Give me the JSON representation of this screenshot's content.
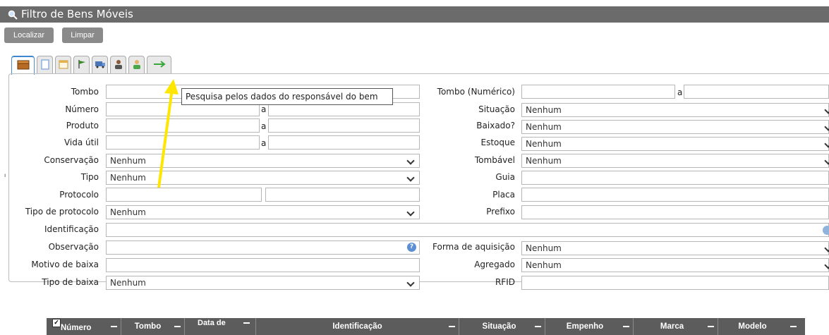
{
  "window": {
    "title": "Filtro de Bens Móveis"
  },
  "toolbar": {
    "search_label": "Localizar",
    "clear_label": "Limpar"
  },
  "tooltip": {
    "text": "Pesquisa pelos dados do responsável do bem"
  },
  "form": {
    "left": {
      "tombo": "Tombo",
      "numero": "Número",
      "produto": "Produto",
      "vida_util": "Vida útil",
      "conservacao": "Conservação",
      "tipo": "Tipo",
      "protocolo": "Protocolo",
      "tipo_protocolo": "Tipo de protocolo",
      "identificacao": "Identificação",
      "observacao": "Observação",
      "motivo_baixa": "Motivo de baixa",
      "tipo_baixa": "Tipo de baixa"
    },
    "right": {
      "tombo_numerico": "Tombo (Numérico)",
      "situacao": "Situação",
      "baixado": "Baixado?",
      "estoque": "Estoque",
      "tombavel": "Tombável",
      "guia": "Guia",
      "placa": "Placa",
      "prefixo": "Prefixo",
      "forma_aquisicao": "Forma de aquisição",
      "agregado": "Agregado",
      "rfid": "RFID"
    },
    "range_sep": "a",
    "select_default": "Nenhum"
  },
  "grid": {
    "columns": [
      "Número",
      "Tombo",
      "Data de",
      "Identificação",
      "Situação",
      "Empenho",
      "Marca",
      "Modelo"
    ]
  },
  "colors": {
    "titlebar": "#6b6b6b",
    "button": "#8a8a8a",
    "grid_header": "#5c5c5c",
    "arrow": "#ffe600"
  }
}
